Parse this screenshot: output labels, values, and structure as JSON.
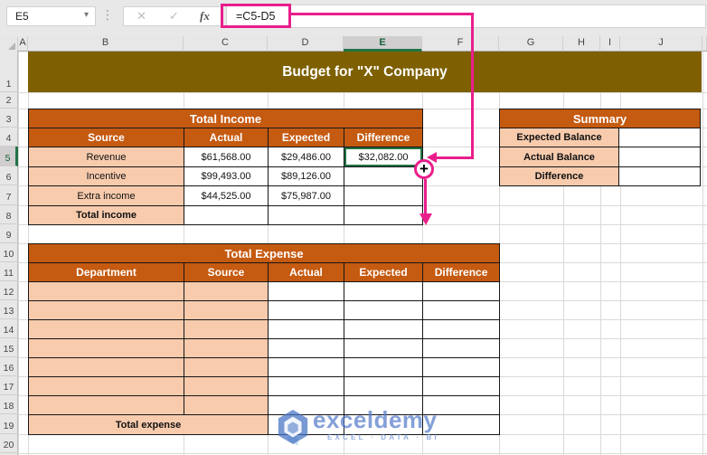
{
  "formula_bar": {
    "name_box": "E5",
    "formula": "=C5-D5",
    "fx_label": "fx"
  },
  "column_headers": [
    "A",
    "B",
    "C",
    "D",
    "E",
    "F",
    "G",
    "H",
    "I",
    "J"
  ],
  "row_headers": [
    "1",
    "2",
    "3",
    "4",
    "5",
    "6",
    "7",
    "8",
    "9",
    "10",
    "11",
    "12",
    "13",
    "14",
    "15",
    "16",
    "17",
    "18",
    "19",
    "20"
  ],
  "banner_title": "Budget for \"X\" Company",
  "income": {
    "title": "Total Income",
    "headers": [
      "Source",
      "Actual",
      "Expected",
      "Difference"
    ],
    "rows": [
      {
        "source": "Revenue",
        "actual": "$61,568.00",
        "expected": "$29,486.00",
        "difference": "$32,082.00"
      },
      {
        "source": "Incentive",
        "actual": "$99,493.00",
        "expected": "$89,126.00",
        "difference": ""
      },
      {
        "source": "Extra income",
        "actual": "$44,525.00",
        "expected": "$75,987.00",
        "difference": ""
      }
    ],
    "total_label": "Total income"
  },
  "summary": {
    "title": "Summary",
    "labels": [
      "Expected Balance",
      "Actual Balance",
      "Difference"
    ]
  },
  "expense": {
    "title": "Total Expense",
    "headers": [
      "Department",
      "Source",
      "Actual",
      "Expected",
      "Difference"
    ],
    "total_label": "Total expense"
  },
  "selection": {
    "cell": "E5",
    "fill_handle_symbol": "+"
  },
  "watermark": {
    "brand": "exceldemy",
    "tagline": "EXCEL · DATA · BI"
  },
  "colors": {
    "accent_orange": "#C55A11",
    "peach": "#F8CBAD",
    "olive_banner": "#7E6000",
    "annotation_pink": "#E91E8C",
    "selection_green": "#217346"
  }
}
